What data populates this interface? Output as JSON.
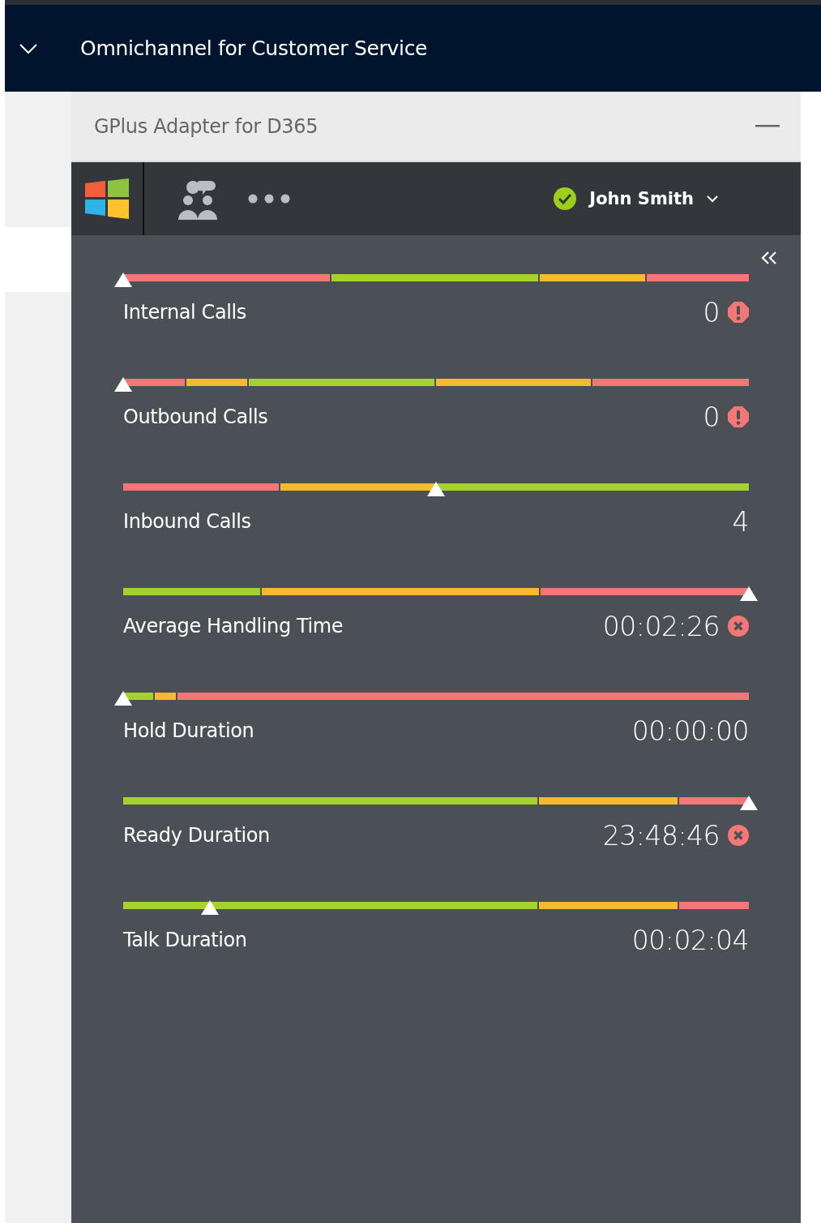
{
  "app_bar": {
    "title": "Omnichannel for Customer Service"
  },
  "panel": {
    "title": "GPlus Adapter for D365"
  },
  "toolbar": {
    "agent": {
      "name": "John Smith",
      "online": true
    }
  },
  "metrics": [
    {
      "label": "Internal Calls",
      "value": "0",
      "kind": "warning",
      "segments": [
        {
          "color": "#f47676"
        },
        {
          "color": "#a6d22e"
        },
        {
          "color": "#f5bb2c"
        },
        {
          "color": "#f47676"
        }
      ]
    },
    {
      "label": "Outbound Calls",
      "value": "0",
      "kind": "warning",
      "segments": [
        {
          "color": "#f47676"
        },
        {
          "color": "#f5bb2c"
        },
        {
          "color": "#a6d22e"
        },
        {
          "color": "#f5bb2c"
        },
        {
          "color": "#f47676"
        }
      ]
    },
    {
      "label": "Inbound Calls",
      "value": "4",
      "kind": "plain",
      "segments": [
        {
          "color": "#f47676"
        },
        {
          "color": "#f5bb2c"
        },
        {
          "color": "#a6d22e"
        }
      ]
    },
    {
      "label": "Average Handling Time",
      "value": "00:02:26",
      "kind": "error",
      "segments": [
        {
          "color": "#a6d22e"
        },
        {
          "color": "#f5bb2c"
        },
        {
          "color": "#f47676"
        }
      ]
    },
    {
      "label": "Hold Duration",
      "value": "00:00:00",
      "kind": "plain",
      "segments": [
        {
          "color": "#a6d22e"
        },
        {
          "color": "#f5bb2c"
        },
        {
          "color": "#f47676"
        }
      ]
    },
    {
      "label": "Ready Duration",
      "value": "23:48:46",
      "kind": "error",
      "segments": [
        {
          "color": "#a6d22e"
        },
        {
          "color": "#f5bb2c"
        },
        {
          "color": "#f47676"
        }
      ]
    },
    {
      "label": "Talk Duration",
      "value": "00:02:04",
      "kind": "plain",
      "segments": [
        {
          "color": "#a6d22e"
        },
        {
          "color": "#f5bb2c"
        },
        {
          "color": "#f47676"
        }
      ]
    }
  ]
}
